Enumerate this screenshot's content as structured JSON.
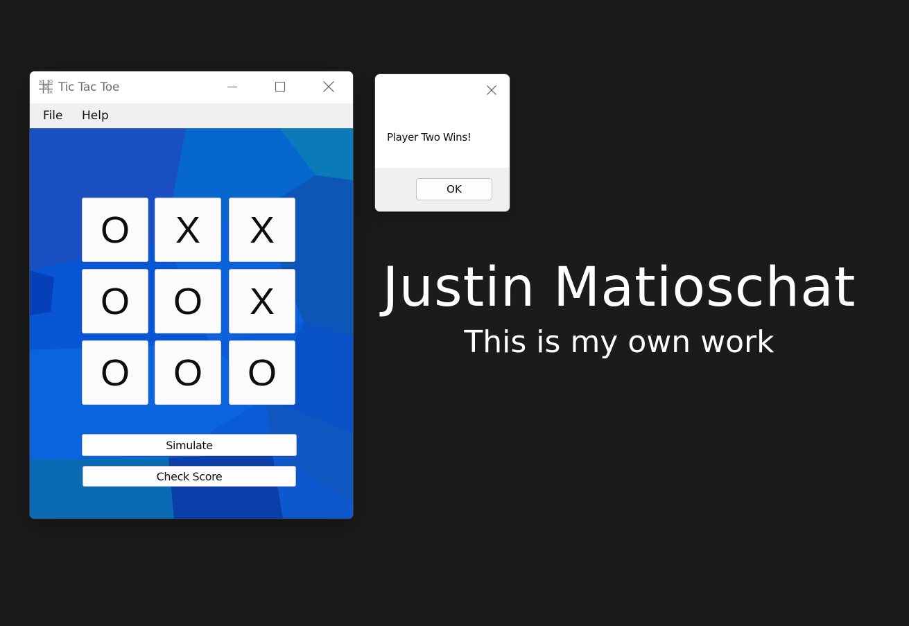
{
  "window": {
    "title": "Tic Tac Toe",
    "icon": "tic-tac-toe-grid-icon",
    "controls": [
      "minimize-icon",
      "maximize-icon",
      "close-icon"
    ]
  },
  "menu": {
    "file_label": "File",
    "help_label": "Help"
  },
  "board": {
    "cells": [
      "O",
      "X",
      "X",
      "O",
      "O",
      "X",
      "O",
      "O",
      "O"
    ]
  },
  "buttons": {
    "simulate_label": "Simulate",
    "check_score_label": "Check Score"
  },
  "dialog": {
    "message": "Player Two Wins!",
    "ok_label": "OK"
  },
  "author": {
    "name": "Justin Matioschat",
    "statement": "This is my own work"
  },
  "colors": {
    "page_background": "#1b1b1b",
    "client_background": "#0a5cd6"
  }
}
